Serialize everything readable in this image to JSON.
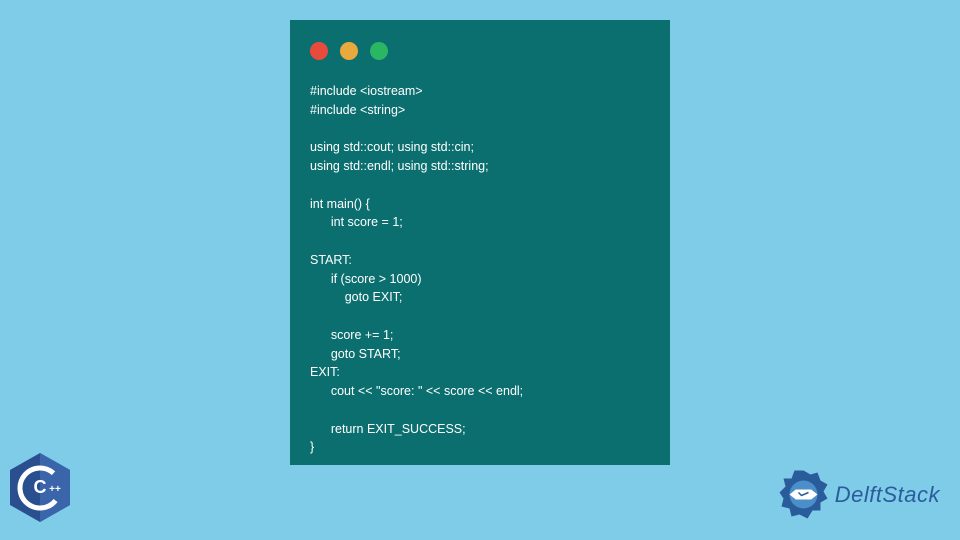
{
  "code": {
    "lines": "#include <iostream>\n#include <string>\n\nusing std::cout; using std::cin;\nusing std::endl; using std::string;\n\nint main() {\n      int score = 1;\n\nSTART:\n      if (score > 1000)\n          goto EXIT;\n\n      score += 1;\n      goto START;\nEXIT:\n      cout << \"score: \" << score << endl;\n\n      return EXIT_SUCCESS;\n}"
  },
  "branding": {
    "delft_label": "DelftStack",
    "cpp_label": "C++"
  },
  "colors": {
    "background": "#7fcce9",
    "window_bg": "#0c6f6f",
    "dot_red": "#e84b3c",
    "dot_yellow": "#e9a93c",
    "dot_green": "#2bb663",
    "code_text": "#ffffff",
    "cpp_blue": "#2a4f8f",
    "delft_blue": "#2a5c9c"
  }
}
